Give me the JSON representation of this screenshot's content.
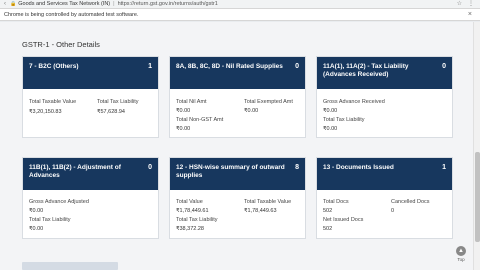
{
  "browser": {
    "site": "Goods and Services Tax Network (IN)",
    "url": "https://return.gst.gov.in/returns/auth/gstr1",
    "info_message": "Chrome is being controlled by automated test software."
  },
  "section": {
    "title": "GSTR-1 - Other Details"
  },
  "cards": [
    {
      "title": "7 - B2C (Others)",
      "count": "1",
      "fields": [
        {
          "label": "Total Taxable Value",
          "value": "₹3,20,150.83"
        },
        {
          "label": "Total Tax Liability",
          "value": "₹57,628.94"
        }
      ]
    },
    {
      "title": "8A, 8B, 8C, 8D - Nil Rated Supplies",
      "count": "0",
      "fields": [
        {
          "label": "Total Nil Amt",
          "value": "₹0.00"
        },
        {
          "label": "Total Exempted Amt",
          "value": "₹0.00"
        },
        {
          "label": "Total Non-GST Amt",
          "value": "₹0.00"
        }
      ]
    },
    {
      "title": "11A(1), 11A(2) - Tax Liability (Advances Received)",
      "count": "0",
      "fields": [
        {
          "label": "Gross Advance Received",
          "value": "₹0.00"
        },
        {
          "label": "Total Tax Liability",
          "value": "₹0.00"
        }
      ]
    },
    {
      "title": "11B(1), 11B(2) - Adjustment of Advances",
      "count": "0",
      "fields": [
        {
          "label": "Gross Advance Adjusted",
          "value": "₹0.00"
        },
        {
          "label": "Total Tax Liability",
          "value": "₹0.00"
        }
      ]
    },
    {
      "title": "12 - HSN-wise summary of outward supplies",
      "count": "8",
      "fields": [
        {
          "label": "Total Value",
          "value": "₹1,78,449.61"
        },
        {
          "label": "Total Taxable Value",
          "value": "₹1,78,449.63"
        },
        {
          "label": "Total Tax Liability",
          "value": "₹38,372.28"
        }
      ]
    },
    {
      "title": "13 - Documents Issued",
      "count": "1",
      "fields": [
        {
          "label": "Total Docs",
          "value": "502"
        },
        {
          "label": "Cancelled Docs",
          "value": "0"
        },
        {
          "label": "Net Issued Docs",
          "value": "502"
        }
      ]
    }
  ],
  "to_top": {
    "label": "Top"
  }
}
